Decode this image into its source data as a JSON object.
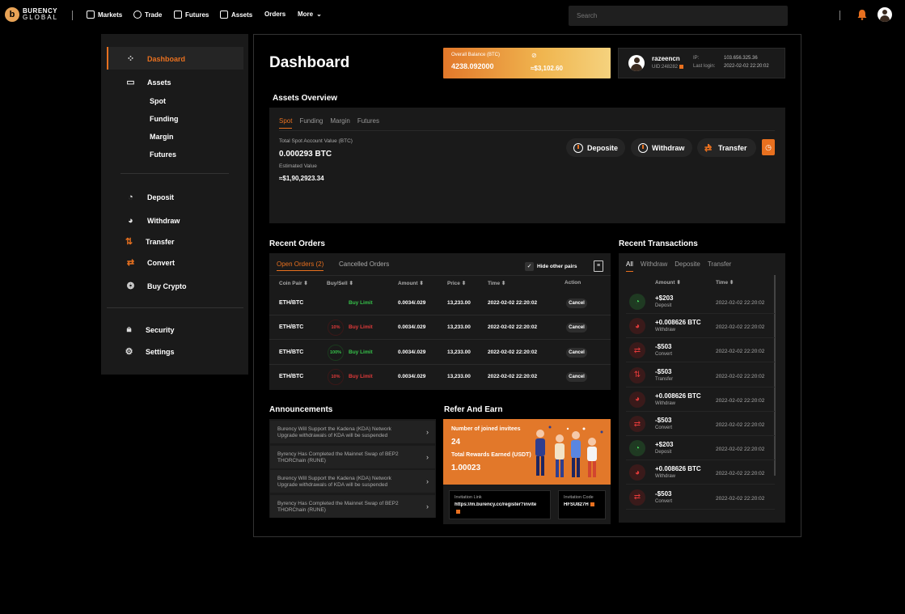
{
  "brand": {
    "line1": "BURENCY",
    "line2": "GLOBAL"
  },
  "nav": {
    "markets": "Markets",
    "trade": "Trade",
    "futures": "Futures",
    "assets": "Assets",
    "orders": "Orders",
    "more": "More"
  },
  "search": {
    "placeholder": "Search"
  },
  "sidebar": {
    "dashboard": "Dashboard",
    "assets": "Assets",
    "spot": "Spot",
    "funding": "Funding",
    "margin": "Margin",
    "futures": "Futures",
    "deposit": "Deposit",
    "withdraw": "Withdraw",
    "transfer": "Transfer",
    "convert": "Convert",
    "buy_crypto": "Buy Crypto",
    "security": "Security",
    "settings": "Settings"
  },
  "dashboard": {
    "title": "Dashboard"
  },
  "balance": {
    "label": "Overall Balance (BTC)",
    "value": "4238.092000",
    "usd": "≈$3,102.60"
  },
  "user": {
    "name": "razeencn",
    "uid": "UID:248282",
    "ip_label": "IP:",
    "ip_value": "103.656.325.36",
    "last_login_label": "Last login:",
    "last_login_value": "2022-02-02 22:20:02"
  },
  "assets_overview": {
    "title": "Assets Overview",
    "tabs": [
      "Spot",
      "Funding",
      "Margin",
      "Futures"
    ],
    "total_label": "Total Spot Account Value (BTC)",
    "total_value": "0.000293 BTC",
    "estimated_label": "Estimated Value",
    "estimated_value": "≈$1,90,2923.34",
    "deposit_btn": "Deposite",
    "withdraw_btn": "Withdraw",
    "transfer_btn": "Transfer"
  },
  "recent_orders": {
    "title": "Recent Orders",
    "tab_open": "Open Orders (2)",
    "tab_cancelled": "Cancelled Orders",
    "hide_pairs": "Hide other pairs",
    "headers": {
      "pair": "Coin Pair",
      "buysell": "Buy/Sell",
      "amount": "Amount",
      "price": "Price",
      "time": "Time",
      "action": "Action"
    },
    "rows": [
      {
        "pair": "ETH/BTC",
        "pct": "",
        "side": "Buy Limit",
        "side_color": "green",
        "amount": "0.0034/.029",
        "price": "13,233.00",
        "time": "2022-02-02 22:20:02",
        "action": "Cancel"
      },
      {
        "pair": "ETH/BTC",
        "pct": "10%",
        "side": "Buy Limit",
        "side_color": "red",
        "amount": "0.0034/.029",
        "price": "13,233.00",
        "time": "2022-02-02 22:20:02",
        "action": "Cancel"
      },
      {
        "pair": "ETH/BTC",
        "pct": "100%",
        "side": "Buy Limit",
        "side_color": "green",
        "amount": "0.0034/.029",
        "price": "13,233.00",
        "time": "2022-02-02 22:20:02",
        "action": "Cancel"
      },
      {
        "pair": "ETH/BTC",
        "pct": "10%",
        "side": "Buy Limit",
        "side_color": "red",
        "amount": "0.0034/.029",
        "price": "13,233.00",
        "time": "2022-02-02 22:20:02",
        "action": "Cancel"
      }
    ]
  },
  "recent_transactions": {
    "title": "Recent Transactions",
    "tabs": [
      "All",
      "Withdraw",
      "Deposite",
      "Transfer"
    ],
    "headers": {
      "amount": "Amount",
      "time": "Time"
    },
    "rows": [
      {
        "amount": "+$203",
        "type": "Deposit",
        "time": "2022-02-02 22:20:02",
        "dir": "in"
      },
      {
        "amount": "+0.008626 BTC",
        "type": "Withdraw",
        "time": "2022-02-02 22:20:02",
        "dir": "out"
      },
      {
        "amount": "-$503",
        "type": "Convert",
        "time": "2022-02-02 22:20:02",
        "dir": "out"
      },
      {
        "amount": "-$503",
        "type": "Transfer",
        "time": "2022-02-02 22:20:02",
        "dir": "out"
      },
      {
        "amount": "+0.008626 BTC",
        "type": "Withdraw",
        "time": "2022-02-02 22:20:02",
        "dir": "out"
      },
      {
        "amount": "-$503",
        "type": "Convert",
        "time": "2022-02-02 22:20:02",
        "dir": "out"
      },
      {
        "amount": "+$203",
        "type": "Deposit",
        "time": "2022-02-02 22:20:02",
        "dir": "in"
      },
      {
        "amount": "+0.008626 BTC",
        "type": "Withdraw",
        "time": "2022-02-02 22:20:02",
        "dir": "out"
      },
      {
        "amount": "-$503",
        "type": "Convert",
        "time": "2022-02-02 22:20:02",
        "dir": "out"
      }
    ]
  },
  "announcements": {
    "title": "Announcements",
    "items": [
      {
        "l1": "Burency Will Support the Kadena (KDA) Network",
        "l2": "Upgrade withdrawals of KDA will be suspended"
      },
      {
        "l1": "Byrency Has Completed the Mainnet Swap of BEP2",
        "l2": "THORChain (RUNE)"
      },
      {
        "l1": "Burency Will Support the Kadena (KDA) Network",
        "l2": "Upgrade withdrawals of KDA will be suspended"
      },
      {
        "l1": "Byrency Has Completed the Mainnet Swap of BEP2",
        "l2": "THORChain (RUNE)"
      }
    ]
  },
  "refer": {
    "title": "Refer And Earn",
    "invitees_label": "Number of joined invitees",
    "invitees_value": "24",
    "rewards_label": "Total Rewards Earned (USDT)",
    "rewards_value": "1.00023",
    "link_label": "Invitation Link",
    "link_value": "https://m.burency.cc/register?invite",
    "code_label": "Invitation Code",
    "code_value": "HFSU827H"
  },
  "colors": {
    "accent": "#e8701f",
    "green": "#36c24a",
    "red": "#e23a3a",
    "panel": "#1a1a1a"
  }
}
